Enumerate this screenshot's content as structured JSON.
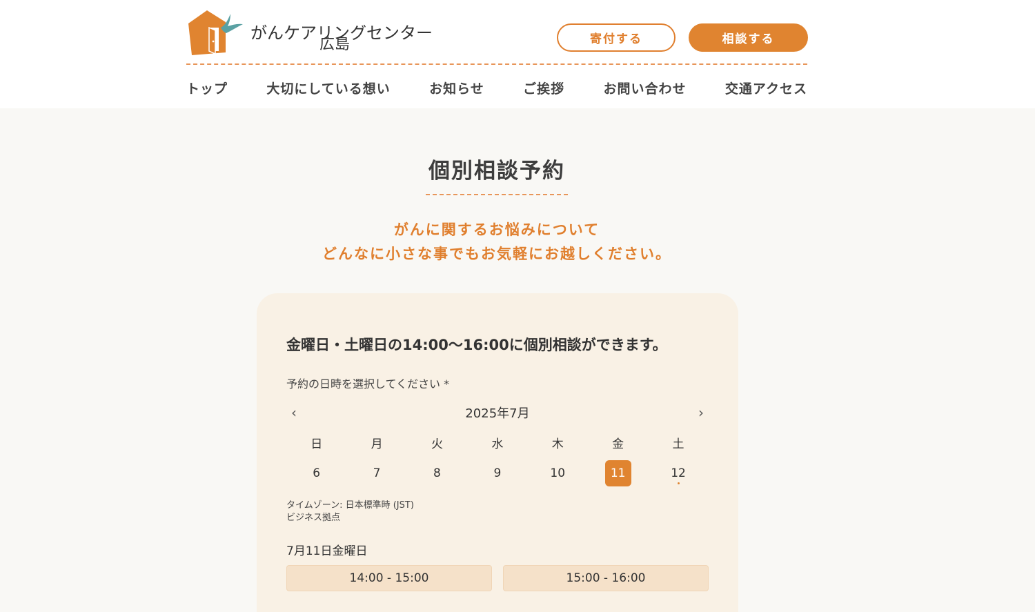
{
  "header": {
    "logo_name": "がんケアリングセンター",
    "logo_sub": "広島",
    "donate_label": "寄付する",
    "consult_label": "相談する"
  },
  "nav": {
    "items": [
      "トップ",
      "大切にしている想い",
      "お知らせ",
      "ご挨拶",
      "お問い合わせ",
      "交通アクセス"
    ]
  },
  "main": {
    "title": "個別相談予約",
    "tagline_1": "がんに関するお悩みについて",
    "tagline_2": "どんなに小さな事でもお気軽にお越しください。"
  },
  "booking": {
    "heading": "金曜日・土曜日の14:00〜16:00に個別相談ができます。",
    "select_label": "予約の日時を選択してください *",
    "month": "2025年7月",
    "prev_icon": "‹",
    "next_icon": "›",
    "weekdays": [
      "日",
      "月",
      "火",
      "水",
      "木",
      "金",
      "土"
    ],
    "days": [
      "6",
      "7",
      "8",
      "9",
      "10",
      "11",
      "12"
    ],
    "selected_day": "11",
    "timezone": "タイムゾーン: 日本標準時 (JST)",
    "location": "ビジネス拠点",
    "selected_date": "7月11日金曜日",
    "slots": [
      "14:00 - 15:00",
      "15:00 - 16:00"
    ]
  },
  "colors": {
    "accent": "#e08430",
    "card_bg": "#f9f1e5",
    "slot_bg": "#f5e1c9",
    "page_bg": "#f9f8f5"
  }
}
